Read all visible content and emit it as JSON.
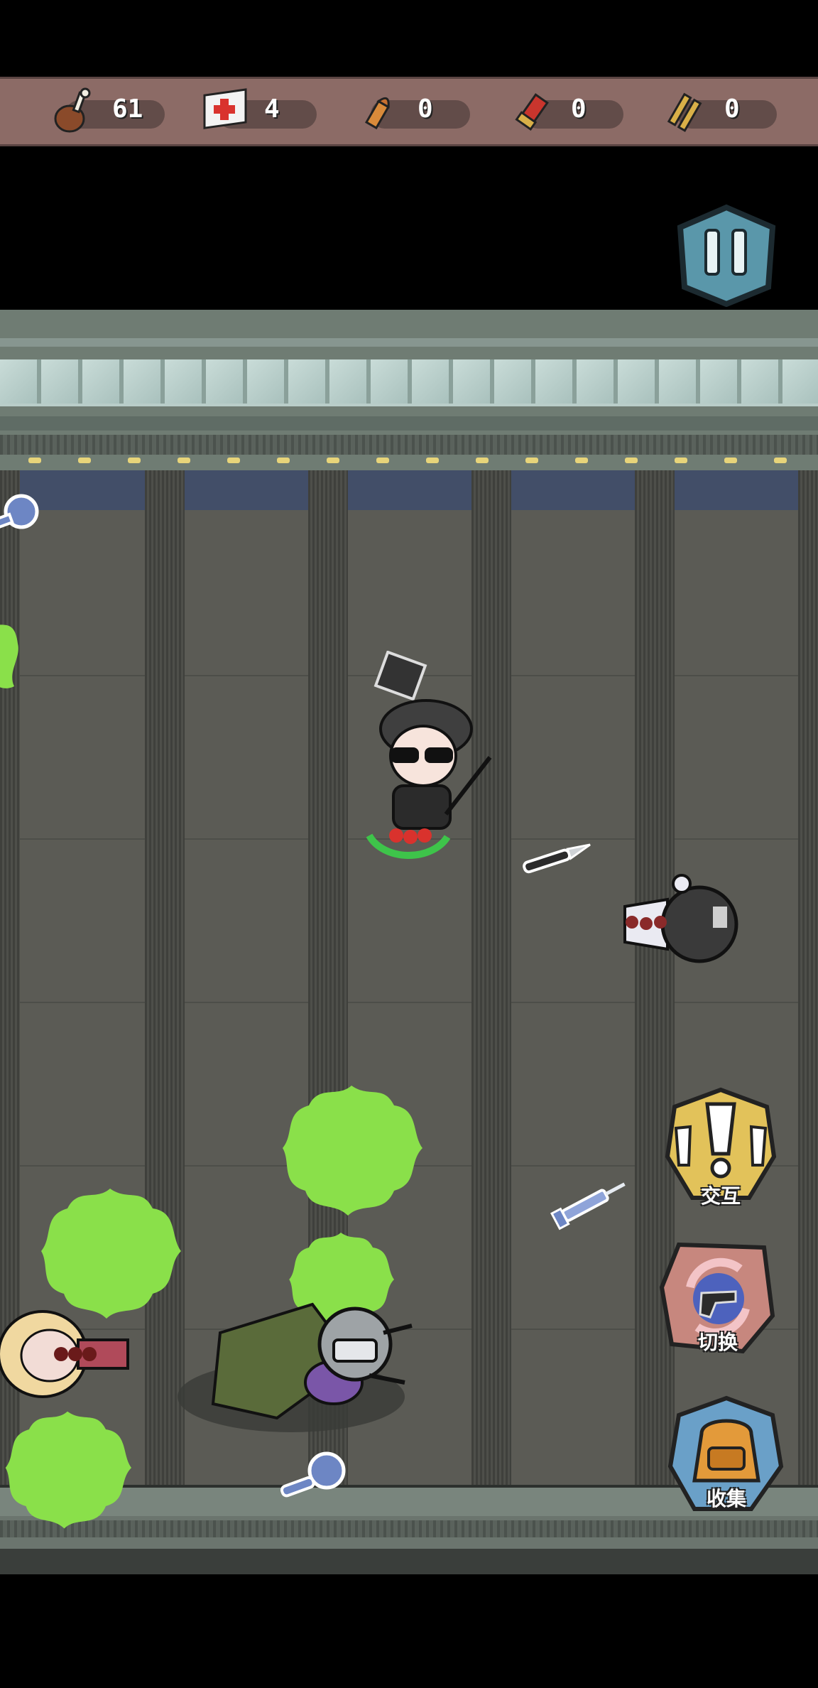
{
  "resources": [
    {
      "icon": "meat-drumstick-icon",
      "count": "61"
    },
    {
      "icon": "medkit-icon",
      "count": "4"
    },
    {
      "icon": "pistol-ammo-icon",
      "count": "0"
    },
    {
      "icon": "shotgun-shell-icon",
      "count": "0"
    },
    {
      "icon": "rifle-ammo-icon",
      "count": "0"
    }
  ],
  "actions": {
    "interact": "交互",
    "switch": "切换",
    "collect": "收集"
  },
  "colors": {
    "resource_bar": "#8c6b66",
    "interact_button": "#e2c25a",
    "switch_button": "#c7877e",
    "collect_button": "#6aa0c8",
    "pause_button": "#5a97aa",
    "slime": "#8ae04a",
    "floor": "#5b5b55"
  }
}
